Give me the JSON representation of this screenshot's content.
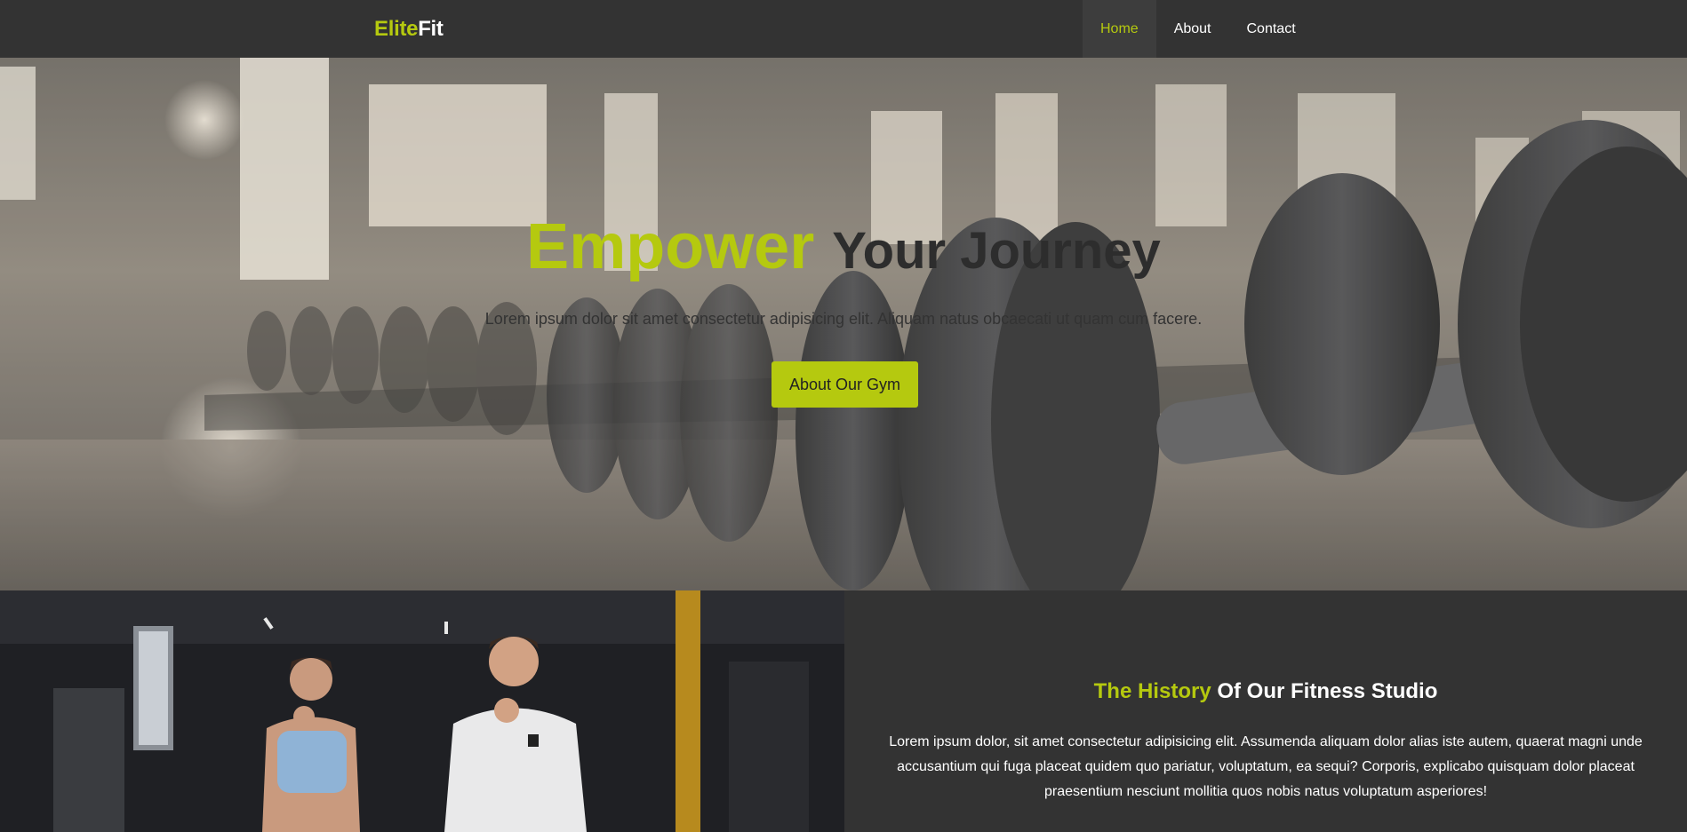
{
  "brand": {
    "accent": "Elite",
    "rest": "Fit"
  },
  "nav": {
    "items": [
      {
        "label": "Home"
      },
      {
        "label": "About"
      },
      {
        "label": "Contact"
      }
    ]
  },
  "hero": {
    "title_accent": "Empower",
    "title_rest": "Your Journey",
    "subtitle": "Lorem ipsum dolor sit amet consectetur adipisicing elit. Aliquam natus obcaecati ut quam cum facere.",
    "button_label": "About Our Gym"
  },
  "history": {
    "title_accent": "The History",
    "title_rest": "Of Our Fitness Studio",
    "body": "Lorem ipsum dolor, sit amet consectetur adipisicing elit. Assumenda aliquam dolor alias iste autem, quaerat magni unde accusantium qui fuga placeat quidem quo pariatur, voluptatum, ea sequi? Corporis, explicabo quisquam dolor placeat praesentium nesciunt mollitia quos nobis natus voluptatum asperiores!"
  },
  "colors": {
    "accent": "#b5c90f",
    "background": "#333333",
    "text": "#ffffff"
  }
}
